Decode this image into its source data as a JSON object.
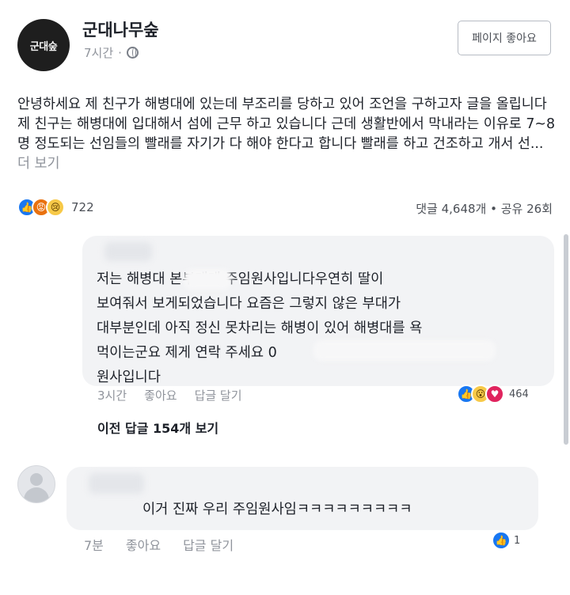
{
  "header": {
    "avatar_text": "군대숲",
    "page_name": "군대나무숲",
    "time": "7시간",
    "like_page_label": "페이지 좋아요"
  },
  "post": {
    "text": "안녕하세요 제 친구가 해병대에 있는데 부조리를 당하고 있어 조언을 구하고자 글을 올립니다 제 친구는 해병대에 입대해서 섬에 근무 하고 있습니다 근데 생활반에서 막내라는 이유로 7~8명 정도되는 선임들의 빨래를 자기가 다 해야 한다고 합니다 빨래를 하고 건조하고 개서 선...",
    "see_more": "더 보기",
    "reaction_count": "722",
    "stats": "댓글 4,648개 • 공유 26회",
    "reactions": [
      "like",
      "angry",
      "sad"
    ]
  },
  "comment1": {
    "text": "저는 해병대 본부대대 주임원사입니다우연히 딸이\n보여줘서 보게되었습니다 요즘은 그렇지 않은 부대가\n대부분인데 아직 정신 못차리는 해병이 있어 해병대를 욕\n먹이는군요 제게 연락 주세요 0\n원사입니다",
    "time": "3시간",
    "like_label": "좋아요",
    "reply_label": "답글 달기",
    "reaction_count": "464",
    "reactions": [
      "like",
      "wow",
      "love"
    ],
    "view_previous": "이전 답글 154개 보기"
  },
  "comment2": {
    "text": "이거 진짜 우리 주임원사임ㅋㅋㅋㅋㅋㅋㅋㅋㅋ",
    "time": "7분",
    "like_label": "좋아요",
    "reply_label": "답글 달기",
    "reaction_count": "1",
    "reactions": [
      "like"
    ]
  },
  "colors": {
    "like": "#1877f2",
    "angry": "#e9710f",
    "sad": "#f7c948",
    "love": "#e0245e",
    "bubble": "#f2f3f5",
    "muted": "#90949c"
  }
}
